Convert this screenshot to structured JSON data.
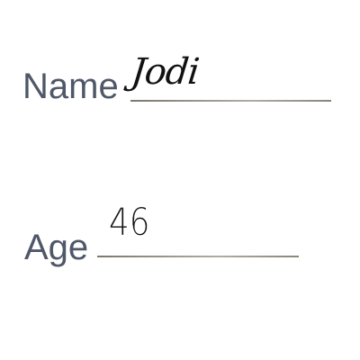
{
  "form": {
    "name": {
      "label": "Name",
      "value": "Jodi"
    },
    "age": {
      "label": "Age",
      "value": "46"
    }
  },
  "colors": {
    "label": "#4f5768",
    "line": "#8a857b",
    "ink": "#111111"
  }
}
